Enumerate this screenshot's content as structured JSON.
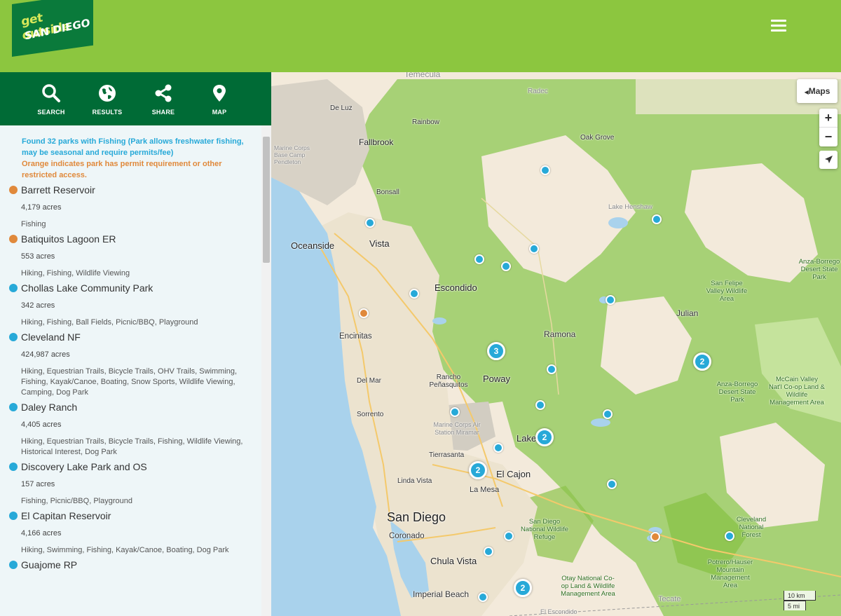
{
  "header": {
    "logo_line1": "get outside",
    "logo_line2": "SAN DIEGO",
    "menu_icon": "hamburger-menu-icon"
  },
  "toolbar": {
    "search": {
      "label": "SEARCH",
      "icon": "search-icon"
    },
    "results": {
      "label": "RESULTS",
      "icon": "globe-icon"
    },
    "share": {
      "label": "SHARE",
      "icon": "share-icon"
    },
    "map": {
      "label": "MAP",
      "icon": "map-pin-icon"
    }
  },
  "summary": {
    "found": "Found 32 parks with Fishing (Park allows freshwater fishing, may be seasonal and require permits/fee)",
    "orange_note": "Orange indicates park has permit requirement or other restricted access."
  },
  "colors": {
    "blue_marker": "#27a9d8",
    "orange_marker": "#e0893b",
    "header_green": "#8cc63f",
    "toolbar_green": "#006b36"
  },
  "parks": [
    {
      "name": "Barrett Reservoir",
      "acres": "4,179 acres",
      "activities": "Fishing",
      "marker": "orange"
    },
    {
      "name": "Batiquitos Lagoon ER",
      "acres": "553 acres",
      "activities": "Hiking, Fishing, Wildlife Viewing",
      "marker": "orange"
    },
    {
      "name": "Chollas Lake Community Park",
      "acres": "342 acres",
      "activities": "Hiking, Fishing, Ball Fields, Picnic/BBQ, Playground",
      "marker": "blue"
    },
    {
      "name": "Cleveland NF",
      "acres": "424,987 acres",
      "activities": "Hiking, Equestrian Trails, Bicycle Trails, OHV Trails, Swimming, Fishing, Kayak/Canoe, Boating, Snow Sports, Wildlife Viewing, Camping, Dog Park",
      "marker": "blue"
    },
    {
      "name": "Daley Ranch",
      "acres": "4,405 acres",
      "activities": "Hiking, Equestrian Trails, Bicycle Trails, Fishing, Wildlife Viewing, Historical Interest, Dog Park",
      "marker": "blue"
    },
    {
      "name": "Discovery Lake Park and OS",
      "acres": "157 acres",
      "activities": "Fishing, Picnic/BBQ, Playground",
      "marker": "blue"
    },
    {
      "name": "El Capitan Reservoir",
      "acres": "4,166 acres",
      "activities": "Hiking, Swimming, Fishing, Kayak/Canoe, Boating, Dog Park",
      "marker": "blue"
    },
    {
      "name": "Guajome RP",
      "acres": "",
      "activities": "",
      "marker": "blue"
    }
  ],
  "map": {
    "maps_button": "Maps",
    "zoom_in": "+",
    "zoom_out": "−",
    "locate_icon": "locate-arrow-icon",
    "scale_km": "10 km",
    "scale_mi": "5 mi",
    "labels": [
      {
        "id": "temecula",
        "text": "Temecula"
      },
      {
        "id": "radec",
        "text": "Radec"
      },
      {
        "id": "deluz",
        "text": "De Luz"
      },
      {
        "id": "rainbow",
        "text": "Rainbow"
      },
      {
        "id": "fallbrook",
        "text": "Fallbrook"
      },
      {
        "id": "oakgrove",
        "text": "Oak Grove"
      },
      {
        "id": "pendleton",
        "text": "Marine Corps Base Camp Pendleton"
      },
      {
        "id": "bonsall",
        "text": "Bonsall"
      },
      {
        "id": "henshaw",
        "text": "Lake Henshaw"
      },
      {
        "id": "oceanside",
        "text": "Oceanside"
      },
      {
        "id": "vista",
        "text": "Vista"
      },
      {
        "id": "anzaborrego1",
        "text": "Anza-Borrego Desert State Park"
      },
      {
        "id": "escondido",
        "text": "Escondido"
      },
      {
        "id": "sanfelipe",
        "text": "San Felipe Valley Wildlife Area"
      },
      {
        "id": "julian",
        "text": "Julian"
      },
      {
        "id": "encinitas",
        "text": "Encinitas"
      },
      {
        "id": "ramona",
        "text": "Ramona"
      },
      {
        "id": "delmar",
        "text": "Del Mar"
      },
      {
        "id": "rancho",
        "text": "Rancho Peñasquitos"
      },
      {
        "id": "poway",
        "text": "Poway"
      },
      {
        "id": "anzaborrego2",
        "text": "Anza-Borrego Desert State Park"
      },
      {
        "id": "mccain",
        "text": "McCain Valley Nat'l Co-op Land & Wildlife Management Area"
      },
      {
        "id": "sorrento",
        "text": "Sorrento"
      },
      {
        "id": "miramar",
        "text": "Marine Corps Air Station Miramar"
      },
      {
        "id": "lakeside",
        "text": "Lake"
      },
      {
        "id": "tierrasanta",
        "text": "Tierrasanta"
      },
      {
        "id": "elcajon",
        "text": "El Cajon"
      },
      {
        "id": "lindavista",
        "text": "Linda Vista"
      },
      {
        "id": "lamesa",
        "text": "La Mesa"
      },
      {
        "id": "sandiego",
        "text": "San Diego"
      },
      {
        "id": "sdnwr",
        "text": "San Diego National Wildlife Refuge"
      },
      {
        "id": "coronado",
        "text": "Coronado"
      },
      {
        "id": "clevelandnf",
        "text": "Cleveland National Forest"
      },
      {
        "id": "chulavista",
        "text": "Chula Vista"
      },
      {
        "id": "potrero",
        "text": "Potrero/Hauser Mountain Management Area"
      },
      {
        "id": "otay",
        "text": "Otay National Co-op Land & Wildlife Management Area"
      },
      {
        "id": "imperial",
        "text": "Imperial Beach"
      },
      {
        "id": "tecate",
        "text": "Tecate"
      },
      {
        "id": "elescondido",
        "text": "El Escondido"
      }
    ],
    "clusters": [
      {
        "id": "c-poway",
        "count": "3"
      },
      {
        "id": "c-anza",
        "count": "2"
      },
      {
        "id": "c-lakeside",
        "count": "2"
      },
      {
        "id": "c-elcajon",
        "count": "2"
      },
      {
        "id": "c-chula",
        "count": "2"
      }
    ]
  }
}
